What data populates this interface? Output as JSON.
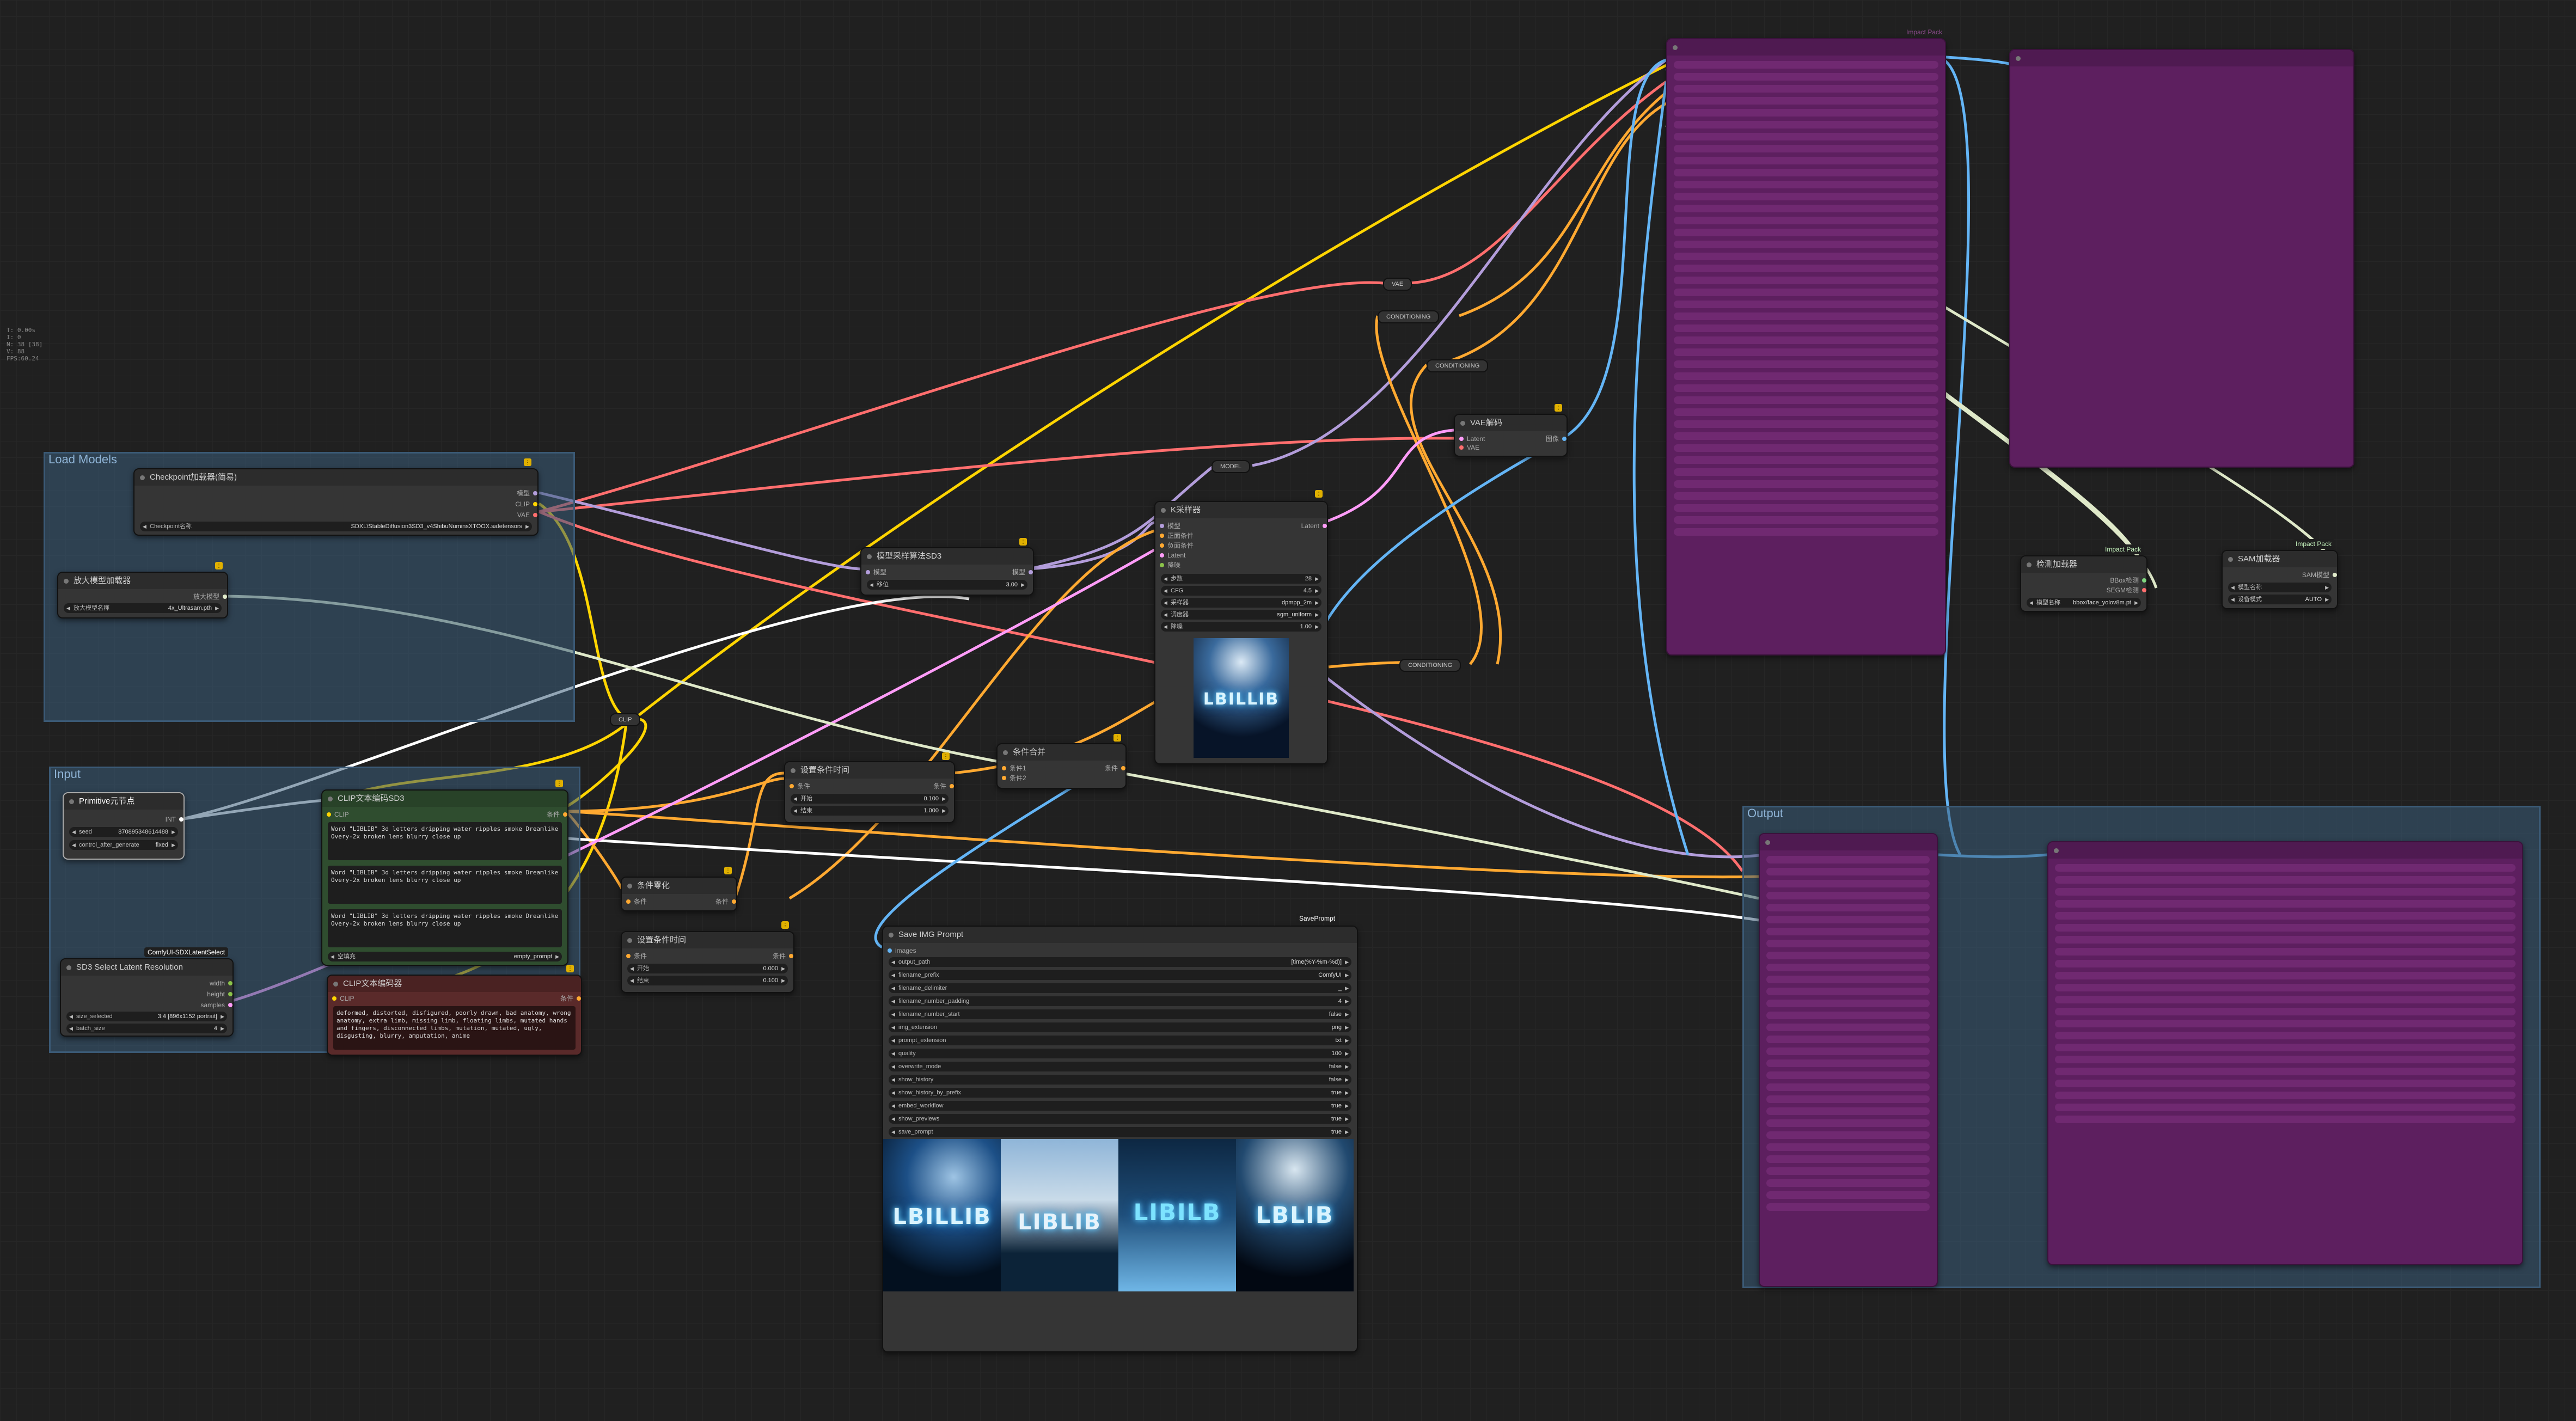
{
  "canvas": {
    "stats": [
      "T: 0.00s",
      "I: 0",
      "N: 38 [38]",
      "V: 88",
      "FPS:60.24"
    ]
  },
  "groups": {
    "load_models": "Load Models",
    "input": "Input",
    "output": "Output"
  },
  "checkpoint_loader": {
    "title": "Checkpoint加载器(简易)",
    "outputs": [
      "模型",
      "CLIP",
      "VAE"
    ],
    "widget_label": "Checkpoint名称",
    "widget_value": "SDXL\\StableDiffusion3SD3_v4ShibuNuminsXTOOX.safetensors"
  },
  "upscale_loader": {
    "title": "放大模型加载器",
    "output": "放大模型",
    "widget_label": "放大模型名称",
    "widget_value": "4x_Ultrasam.pth"
  },
  "primitive": {
    "title": "Primitive元节点",
    "output": "INT",
    "seed_label": "seed",
    "seed_value": "870895348614488",
    "control_label": "control_after_generate",
    "control_value": "fixed"
  },
  "resolution": {
    "badge": "ComfyUI-SDXLatentSelect",
    "title": "SD3 Select Latent Resolution",
    "outputs": [
      "width",
      "height",
      "samples"
    ],
    "size_label": "size_selected",
    "size_value": "3:4 [896x1152 portrait]",
    "batch_label": "batch_size",
    "batch_value": "4"
  },
  "clip_pos": {
    "title": "CLIP文本编码SD3",
    "input": "CLIP",
    "output": "条件",
    "texts": [
      "Word \"LIBLIB\" 3d letters dripping water ripples smoke Dreamlike Overy-2x broken lens blurry close up",
      "Word \"LIBLIB\" 3d letters dripping water ripples smoke Dreamlike Overy-2x broken lens blurry close up",
      "Word \"LIBLIB\" 3d letters dripping water ripples smoke Dreamlike Overy-2x broken lens blurry close up"
    ],
    "empty_label": "空填充",
    "empty_value": "empty_prompt"
  },
  "clip_neg": {
    "title": "CLIP文本编码器",
    "input": "CLIP",
    "output": "条件",
    "text": "deformed, distorted, disfigured, poorly drawn, bad anatomy, wrong anatomy, extra limb, missing limb, floating limbs, mutated hands and fingers, disconnected limbs, mutation, mutated, ugly, disgusting, blurry, amputation, anime"
  },
  "cond_zero": {
    "title": "条件零化",
    "input": "条件",
    "output": "条件"
  },
  "cond_timestep1": {
    "title": "设置条件时间",
    "input": "条件",
    "output": "条件",
    "start_label": "开始",
    "start_value": "0.100",
    "end_label": "结束",
    "end_value": "1.000"
  },
  "cond_timestep2": {
    "title": "设置条件时间",
    "input": "条件",
    "output": "条件",
    "start_label": "开始",
    "start_value": "0.000",
    "end_label": "结束",
    "end_value": "0.100"
  },
  "cond_combine": {
    "title": "条件合并",
    "inputs": [
      "条件1",
      "条件2"
    ],
    "output": "条件"
  },
  "model_sampling": {
    "title": "模型采样算法SD3",
    "input": "模型",
    "output": "模型",
    "shift_label": "移位",
    "shift_value": "3.00"
  },
  "ksampler": {
    "title": "K采样器",
    "inputs": [
      "模型",
      "正面条件",
      "负面条件",
      "Latent",
      "降噪"
    ],
    "output": "Latent",
    "widgets": [
      {
        "label": "步数",
        "value": "28"
      },
      {
        "label": "CFG",
        "value": "4.5"
      },
      {
        "label": "采样器",
        "value": "dpmpp_2m"
      },
      {
        "label": "调度器",
        "value": "sgm_uniform"
      },
      {
        "label": "降噪",
        "value": "1.00"
      }
    ],
    "preview_word": "LBILLIB"
  },
  "vae_decode": {
    "title": "VAE解码",
    "inputs": [
      "Latent",
      "VAE"
    ],
    "output": "图像"
  },
  "reroutes": {
    "vae": "VAE",
    "cond1": "CONDITIONING",
    "cond2": "CONDITIONING",
    "cond3": "CONDITIONING",
    "model": "MODEL",
    "clip": "CLIP"
  },
  "save_img": {
    "badge": "SavePrompt",
    "title": "Save IMG Prompt",
    "input": "images",
    "widgets": [
      {
        "label": "output_path",
        "value": "[time(%Y-%m-%d)]"
      },
      {
        "label": "filename_prefix",
        "value": "ComfyUI"
      },
      {
        "label": "filename_delimiter",
        "value": "_"
      },
      {
        "label": "filename_number_padding",
        "value": "4"
      },
      {
        "label": "filename_number_start",
        "value": "false"
      },
      {
        "label": "img_extension",
        "value": "png"
      },
      {
        "label": "prompt_extension",
        "value": "txt"
      },
      {
        "label": "quality",
        "value": "100"
      },
      {
        "label": "overwrite_mode",
        "value": "false"
      },
      {
        "label": "show_history",
        "value": "false"
      },
      {
        "label": "show_history_by_prefix",
        "value": "true"
      },
      {
        "label": "embed_workflow",
        "value": "true"
      },
      {
        "label": "show_previews",
        "value": "true"
      },
      {
        "label": "save_prompt",
        "value": "true"
      }
    ],
    "preview_words": [
      "LBILLIB",
      "LIBLIB",
      "LIBILB",
      "LBLIB"
    ]
  },
  "impact_detailer": {
    "badge": "Impact Pack"
  },
  "bbox_loader": {
    "badge": "Impact Pack",
    "title": "检测加载器",
    "outputs": [
      "BBox检测",
      "SEGM检测"
    ],
    "widget_label": "模型名称",
    "widget_value": "bbox/face_yolov8m.pt"
  },
  "sam_loader": {
    "badge": "Impact Pack",
    "title": "SAM加载器",
    "output": "SAM模型",
    "widget1_label": "模型名称",
    "widget1_value": "sam_vit_b_01ec64.pth",
    "widget2_label": "设备模式",
    "widget2_value": "AUTO"
  },
  "colors": {
    "model": "#b39ddb",
    "clip": "#ffd500",
    "vae": "#ff6e6e",
    "conditioning": "#ffa931",
    "latent": "#ff9cf9",
    "image": "#64b5f6",
    "int": "#ffffff",
    "upscale": "#dfe9c9"
  }
}
